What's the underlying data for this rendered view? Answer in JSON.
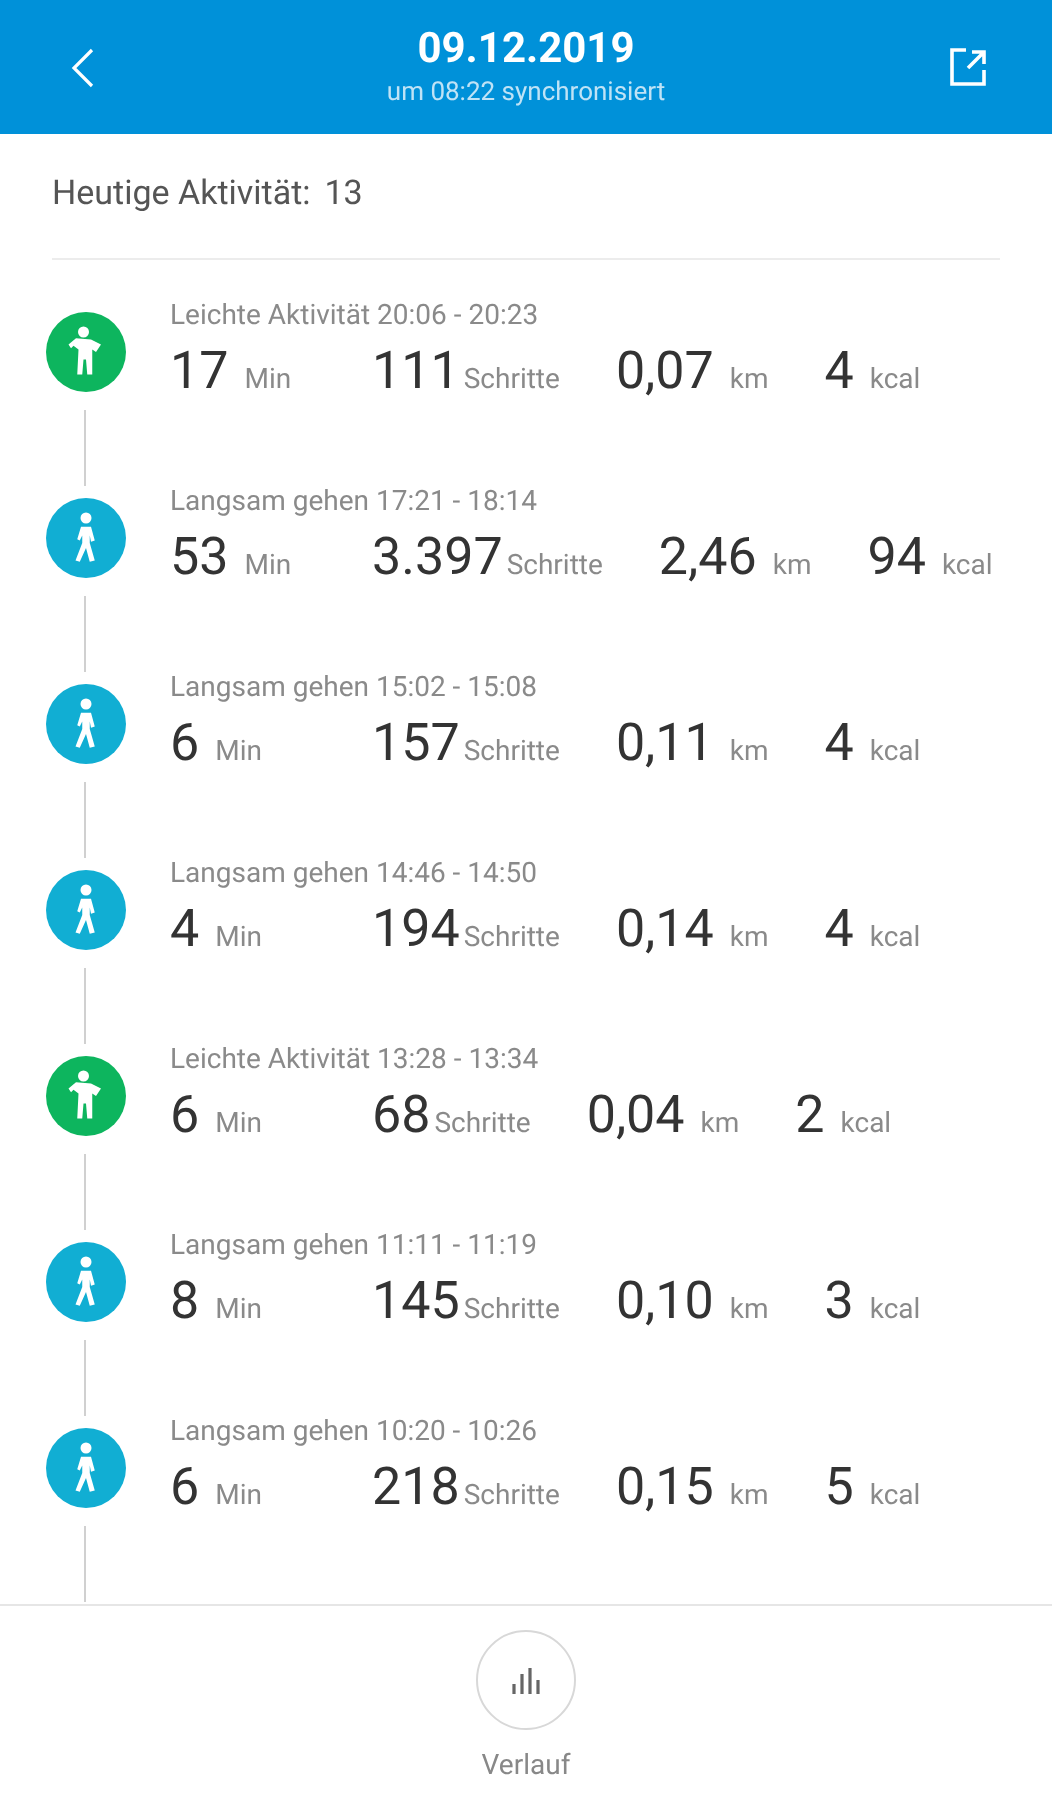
{
  "header": {
    "title": "09.12.2019",
    "subtitle": "um 08:22 synchronisiert"
  },
  "summary": {
    "label": "Heutige Aktivität:",
    "value": "13"
  },
  "activities": [
    {
      "kind": "light",
      "title": "Leichte Aktivität 20:06 - 20:23",
      "metrics": [
        {
          "value": "17",
          "unit": "Min"
        },
        {
          "value": "111",
          "unit": "Schritte"
        },
        {
          "value": "0,07",
          "unit": "km"
        },
        {
          "value": "4",
          "unit": "kcal"
        }
      ]
    },
    {
      "kind": "walk",
      "title": "Langsam gehen 17:21 - 18:14",
      "metrics": [
        {
          "value": "53",
          "unit": "Min"
        },
        {
          "value": "3.397",
          "unit": "Schritte"
        },
        {
          "value": "2,46",
          "unit": "km"
        },
        {
          "value": "94",
          "unit": "kcal"
        }
      ]
    },
    {
      "kind": "walk",
      "title": "Langsam gehen 15:02 - 15:08",
      "metrics": [
        {
          "value": "6",
          "unit": "Min"
        },
        {
          "value": "157",
          "unit": "Schritte"
        },
        {
          "value": "0,11",
          "unit": "km"
        },
        {
          "value": "4",
          "unit": "kcal"
        }
      ]
    },
    {
      "kind": "walk",
      "title": "Langsam gehen 14:46 - 14:50",
      "metrics": [
        {
          "value": "4",
          "unit": "Min"
        },
        {
          "value": "194",
          "unit": "Schritte"
        },
        {
          "value": "0,14",
          "unit": "km"
        },
        {
          "value": "4",
          "unit": "kcal"
        }
      ]
    },
    {
      "kind": "light",
      "title": "Leichte Aktivität 13:28 - 13:34",
      "metrics": [
        {
          "value": "6",
          "unit": "Min"
        },
        {
          "value": "68",
          "unit": "Schritte"
        },
        {
          "value": "0,04",
          "unit": "km"
        },
        {
          "value": "2",
          "unit": "kcal"
        }
      ]
    },
    {
      "kind": "walk",
      "title": "Langsam gehen 11:11 - 11:19",
      "metrics": [
        {
          "value": "8",
          "unit": "Min"
        },
        {
          "value": "145",
          "unit": "Schritte"
        },
        {
          "value": "0,10",
          "unit": "km"
        },
        {
          "value": "3",
          "unit": "kcal"
        }
      ]
    },
    {
      "kind": "walk",
      "title": "Langsam gehen 10:20 - 10:26",
      "metrics": [
        {
          "value": "6",
          "unit": "Min"
        },
        {
          "value": "218",
          "unit": "Schritte"
        },
        {
          "value": "0,15",
          "unit": "km"
        },
        {
          "value": "5",
          "unit": "kcal"
        }
      ]
    }
  ],
  "bottom": {
    "label": "Verlauf"
  }
}
